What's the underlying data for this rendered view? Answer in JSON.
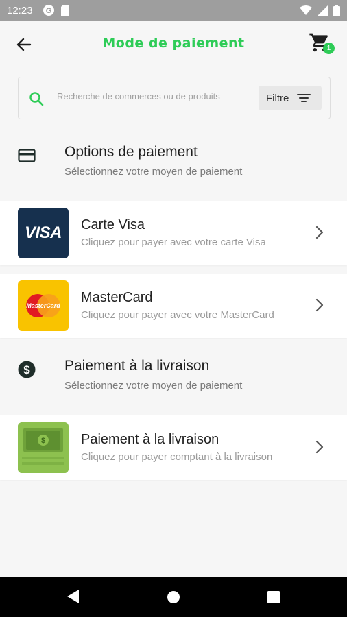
{
  "status_bar": {
    "time": "12:23",
    "left_icons": [
      "circle-g-icon",
      "sd-card-icon"
    ],
    "right_icons": [
      "wifi-icon",
      "signal-icon",
      "battery-icon"
    ]
  },
  "app_bar": {
    "title": "Mode de paiement",
    "cart_count": "1",
    "accent_color": "#2ecc57"
  },
  "search": {
    "placeholder": "Recherche de commerces ou de produits",
    "filter_label": "Filtre"
  },
  "sections": [
    {
      "title": "Options de paiement",
      "subtitle": "Sélectionnez votre moyen de paiement",
      "icon": "credit-card-icon"
    },
    {
      "title": "Paiement à la livraison",
      "subtitle": "Sélectionnez votre moyen de paiement",
      "icon": "dollar-circle-icon"
    }
  ],
  "options": [
    {
      "title": "Carte Visa",
      "subtitle": "Cliquez pour payer avec votre carte Visa",
      "logo_text": "VISA"
    },
    {
      "title": "MasterCard",
      "subtitle": "Cliquez pour payer avec votre MasterCard",
      "logo_text": "MasterCard"
    },
    {
      "title": "Paiement à la livraison",
      "subtitle": "Cliquez pour payer comptant à la livraison",
      "logo_text": "$"
    }
  ],
  "nav_bar": {
    "buttons": [
      "back-triangle-icon",
      "home-circle-icon",
      "recents-square-icon"
    ]
  }
}
